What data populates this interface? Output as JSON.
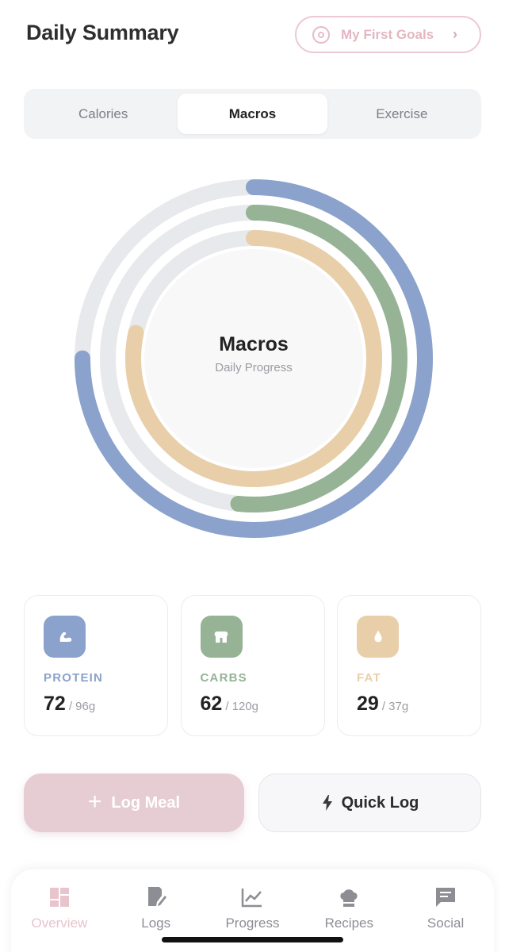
{
  "header": {
    "title": "Daily Summary",
    "goals_label": "My First Goals",
    "goals_chevron": "›"
  },
  "segments": [
    {
      "label": "Calories",
      "active": false
    },
    {
      "label": "Macros",
      "active": true
    },
    {
      "label": "Exercise",
      "active": false
    }
  ],
  "rings": {
    "title": "Macros",
    "subtitle": "Daily Progress",
    "track_color": "#e8e9ec",
    "progress": [
      {
        "name": "protein",
        "fraction": 0.75,
        "color": "#8aa2cc"
      },
      {
        "name": "carbs",
        "fraction": 0.5167,
        "color": "#96b396"
      },
      {
        "name": "fat",
        "fraction": 0.7838,
        "color": "#e9cfa9"
      }
    ]
  },
  "macros": [
    {
      "label": "PROTEIN",
      "value": "72",
      "total": "/ 96g",
      "color": "#8aa2cc",
      "icon": "bicep-icon"
    },
    {
      "label": "CARBS",
      "value": "62",
      "total": "/ 120g",
      "color": "#96b396",
      "icon": "bread-icon"
    },
    {
      "label": "FAT",
      "value": "29",
      "total": "/ 37g",
      "color": "#e9cfa9",
      "icon": "droplet-icon"
    }
  ],
  "actions": {
    "log_meal": "Log Meal",
    "quick_log": "Quick Log"
  },
  "tabbar": [
    {
      "label": "Overview",
      "icon": "dashboard-icon",
      "active": true
    },
    {
      "label": "Logs",
      "icon": "notebook-icon",
      "active": false
    },
    {
      "label": "Progress",
      "icon": "chart-icon",
      "active": false
    },
    {
      "label": "Recipes",
      "icon": "chef-hat-icon",
      "active": false
    },
    {
      "label": "Social",
      "icon": "chat-icon",
      "active": false
    }
  ]
}
